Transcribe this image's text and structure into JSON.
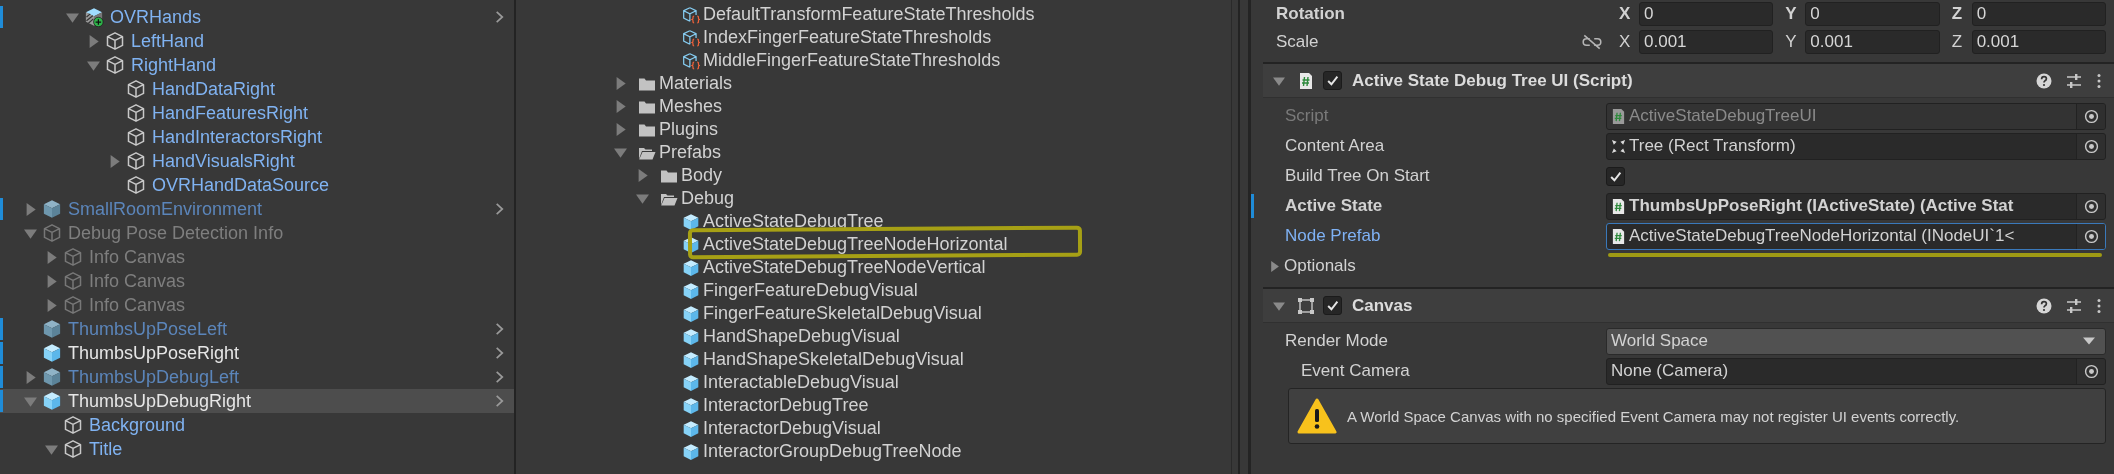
{
  "hierarchy": {
    "items": [
      {
        "kind": "continued",
        "children": [
          {
            "kind": "prefab-added",
            "name": "OVRHands",
            "prefab_instance": true,
            "active": true,
            "expanded": true,
            "overridden": true,
            "prefab_root": true,
            "selected": false,
            "children": [
              {
                "kind": "object",
                "name": "LeftHand",
                "prefab_instance": true,
                "active": true,
                "expanded": false,
                "overridden": false,
                "prefab_root": false,
                "selected": false
              },
              {
                "kind": "object",
                "name": "RightHand",
                "prefab_instance": true,
                "active": true,
                "expanded": true,
                "overridden": false,
                "prefab_root": false,
                "selected": false,
                "children": [
                  {
                    "kind": "object",
                    "name": "HandDataRight",
                    "prefab_instance": true,
                    "active": true,
                    "overridden": false,
                    "prefab_root": false,
                    "selected": false
                  },
                  {
                    "kind": "object",
                    "name": "HandFeaturesRight",
                    "prefab_instance": true,
                    "active": true,
                    "overridden": false,
                    "prefab_root": false,
                    "selected": false
                  },
                  {
                    "kind": "object",
                    "name": "HandInteractorsRight",
                    "prefab_instance": true,
                    "active": true,
                    "overridden": false,
                    "prefab_root": false,
                    "selected": false
                  },
                  {
                    "kind": "object",
                    "name": "HandVisualsRight",
                    "prefab_instance": true,
                    "active": true,
                    "expanded": false,
                    "overridden": false,
                    "prefab_root": false,
                    "selected": false
                  },
                  {
                    "kind": "object",
                    "name": "OVRHandDataSource",
                    "prefab_instance": true,
                    "active": true,
                    "overridden": false,
                    "prefab_root": false,
                    "selected": false
                  }
                ]
              }
            ]
          }
        ]
      },
      {
        "kind": "prefab",
        "name": "SmallRoomEnvironment",
        "prefab_instance": true,
        "active": false,
        "expanded": false,
        "overridden": true,
        "prefab_root": true,
        "selected": false
      },
      {
        "kind": "object",
        "name": "Debug Pose Detection Info",
        "prefab_instance": false,
        "active": false,
        "expanded": true,
        "overridden": false,
        "prefab_root": false,
        "selected": false,
        "children": [
          {
            "kind": "object",
            "name": "Info Canvas",
            "prefab_instance": false,
            "active": false,
            "expanded": false,
            "overridden": false,
            "prefab_root": false,
            "selected": false
          },
          {
            "kind": "object",
            "name": "Info Canvas",
            "prefab_instance": false,
            "active": false,
            "expanded": false,
            "overridden": false,
            "prefab_root": false,
            "selected": false
          },
          {
            "kind": "object",
            "name": "Info Canvas",
            "prefab_instance": false,
            "active": false,
            "expanded": false,
            "overridden": false,
            "prefab_root": false,
            "selected": false
          }
        ]
      },
      {
        "kind": "prefab",
        "name": "ThumbsUpPoseLeft",
        "prefab_instance": true,
        "active": false,
        "overridden": true,
        "prefab_root": true,
        "selected": false
      },
      {
        "kind": "prefab",
        "name": "ThumbsUpPoseRight",
        "prefab_instance": false,
        "active": true,
        "overridden": true,
        "prefab_root": true,
        "selected": false
      },
      {
        "kind": "prefab",
        "name": "ThumbsUpDebugLeft",
        "prefab_instance": true,
        "active": false,
        "expanded": false,
        "overridden": true,
        "prefab_root": true,
        "selected": false
      },
      {
        "kind": "prefab",
        "name": "ThumbsUpDebugRight",
        "prefab_instance": false,
        "active": true,
        "expanded": true,
        "overridden": true,
        "prefab_root": true,
        "selected": true,
        "children": [
          {
            "kind": "object",
            "name": "Background",
            "prefab_instance": true,
            "active": true,
            "overridden": false,
            "prefab_root": false,
            "selected": false
          },
          {
            "kind": "object",
            "name": "Title",
            "prefab_instance": true,
            "active": true,
            "expanded": true,
            "overridden": false,
            "prefab_root": false,
            "selected": false
          }
        ]
      }
    ]
  },
  "project": {
    "items": [
      {
        "kind": "continued",
        "children": [
          {
            "kind": "asset",
            "name": "DefaultTransformFeatureStateThresholds",
            "selected": false
          },
          {
            "kind": "asset",
            "name": "IndexFingerFeatureStateThresholds",
            "selected": false
          },
          {
            "kind": "asset",
            "name": "MiddleFingerFeatureStateThresholds",
            "selected": false
          }
        ]
      },
      {
        "kind": "folder",
        "name": "Materials",
        "expanded": false,
        "selected": false
      },
      {
        "kind": "folder",
        "name": "Meshes",
        "expanded": false,
        "selected": false
      },
      {
        "kind": "folder",
        "name": "Plugins",
        "expanded": false,
        "selected": false
      },
      {
        "kind": "folder",
        "name": "Prefabs",
        "expanded": true,
        "selected": false,
        "children": [
          {
            "kind": "folder",
            "name": "Body",
            "expanded": false,
            "selected": false
          },
          {
            "kind": "folder",
            "name": "Debug",
            "expanded": true,
            "selected": false,
            "children": [
              {
                "kind": "prefab",
                "name": "ActiveStateDebugTree",
                "selected": false,
                "highlighted": false
              },
              {
                "kind": "prefab",
                "name": "ActiveStateDebugTreeNodeHorizontal",
                "selected": false,
                "highlighted": true
              },
              {
                "kind": "prefab",
                "name": "ActiveStateDebugTreeNodeVertical",
                "selected": false,
                "highlighted": false
              },
              {
                "kind": "prefab",
                "name": "FingerFeatureDebugVisual",
                "selected": false,
                "highlighted": false
              },
              {
                "kind": "prefab",
                "name": "FingerFeatureSkeletalDebugVisual",
                "selected": false,
                "highlighted": false
              },
              {
                "kind": "prefab",
                "name": "HandShapeDebugVisual",
                "selected": false,
                "highlighted": false
              },
              {
                "kind": "prefab",
                "name": "HandShapeSkeletalDebugVisual",
                "selected": false,
                "highlighted": false
              },
              {
                "kind": "prefab",
                "name": "InteractableDebugVisual",
                "selected": false,
                "highlighted": false
              },
              {
                "kind": "prefab",
                "name": "InteractorDebugTree",
                "selected": false,
                "highlighted": false
              },
              {
                "kind": "prefab",
                "name": "InteractorDebugVisual",
                "selected": false,
                "highlighted": false
              },
              {
                "kind": "prefab",
                "name": "InteractorGroupDebugTreeNode",
                "selected": false,
                "highlighted": false
              }
            ]
          }
        ]
      }
    ]
  },
  "inspector": {
    "transform": [
      {
        "label": "Rotation",
        "overridden": true,
        "constrain": false,
        "axes": [
          {
            "axis": "X",
            "value": "0"
          },
          {
            "axis": "Y",
            "value": "0"
          },
          {
            "axis": "Z",
            "value": "0"
          }
        ]
      },
      {
        "label": "Scale",
        "overridden": false,
        "constrain": true,
        "axes": [
          {
            "axis": "X",
            "value": "0.001"
          },
          {
            "axis": "Y",
            "value": "0.001"
          },
          {
            "axis": "Z",
            "value": "0.001"
          }
        ]
      }
    ],
    "components": [
      {
        "kind": "script",
        "title": "Active State Debug Tree UI (Script)",
        "enabled": true,
        "expanded": true,
        "fields": [
          {
            "kind": "script-ref",
            "label": "Script",
            "value": "ActiveStateDebugTreeUI",
            "disabled": true,
            "overridden": false,
            "focused": false,
            "underlined": false
          },
          {
            "kind": "transform-ref",
            "label": "Content Area",
            "value": "Tree (Rect Transform)",
            "disabled": false,
            "overridden": false,
            "focused": false,
            "underlined": false
          },
          {
            "kind": "checkbox",
            "label": "Build Tree On Start",
            "checked": true
          },
          {
            "kind": "script-ref",
            "label": "Active State",
            "value": "ThumbsUpPoseRight (IActiveState) (Active Stat",
            "disabled": false,
            "overridden": true,
            "focused": false,
            "underlined": false
          },
          {
            "kind": "script-ref",
            "label": "Node Prefab",
            "value": "ActiveStateDebugTreeNodeHorizontal (INodeUI`1<",
            "disabled": false,
            "overridden": false,
            "focused": true,
            "underlined": true
          },
          {
            "kind": "foldout",
            "label": "Optionals",
            "expanded": false
          }
        ]
      },
      {
        "kind": "canvas",
        "title": "Canvas",
        "enabled": true,
        "expanded": true,
        "fields": [
          {
            "kind": "dropdown",
            "label": "Render Mode",
            "value": "World Space",
            "children": [
              {
                "kind": "object-ref",
                "label": "Event Camera",
                "value": "None (Camera)",
                "disabled": false,
                "overridden": false,
                "focused": false,
                "underlined": false
              },
              {
                "kind": "warning",
                "message": "A World Space Canvas with no specified Event Camera may not register UI events correctly."
              }
            ]
          }
        ]
      }
    ]
  }
}
